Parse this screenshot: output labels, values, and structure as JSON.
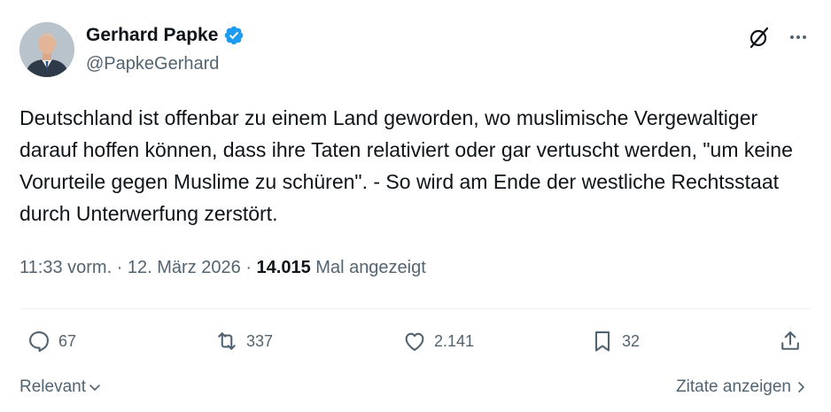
{
  "author": {
    "name": "Gerhard Papke",
    "handle": "@PapkeGerhard",
    "verified": true,
    "verified_color": "#1d9bf0"
  },
  "tweet": {
    "text": "Deutschland ist offenbar zu einem Land geworden, wo muslimische Vergewaltiger darauf hoffen können, dass ihre Taten relativiert oder gar vertuscht werden, \"um keine Vorurteile gegen Muslime zu schüren\". - So wird am Ende der westliche Rechtsstaat durch Unterwerfung zerstört."
  },
  "meta": {
    "time": "11:33 vorm.",
    "separator": " · ",
    "date": "12. März 2026",
    "views": "14.015",
    "views_label": "Mal angezeigt"
  },
  "actions": {
    "replies": "67",
    "reposts": "337",
    "likes": "2.141",
    "bookmarks": "32"
  },
  "footer": {
    "sort_label": "Relevant",
    "quotes_label": "Zitate anzeigen"
  },
  "icons": [
    "grok-icon",
    "more-icon",
    "reply-icon",
    "repost-icon",
    "like-icon",
    "bookmark-icon",
    "share-icon",
    "chevron-down-icon",
    "chevron-right-icon",
    "verified-badge-icon"
  ],
  "colors": {
    "text": "#0f1419",
    "secondary": "#536471",
    "accent": "#1d9bf0"
  }
}
